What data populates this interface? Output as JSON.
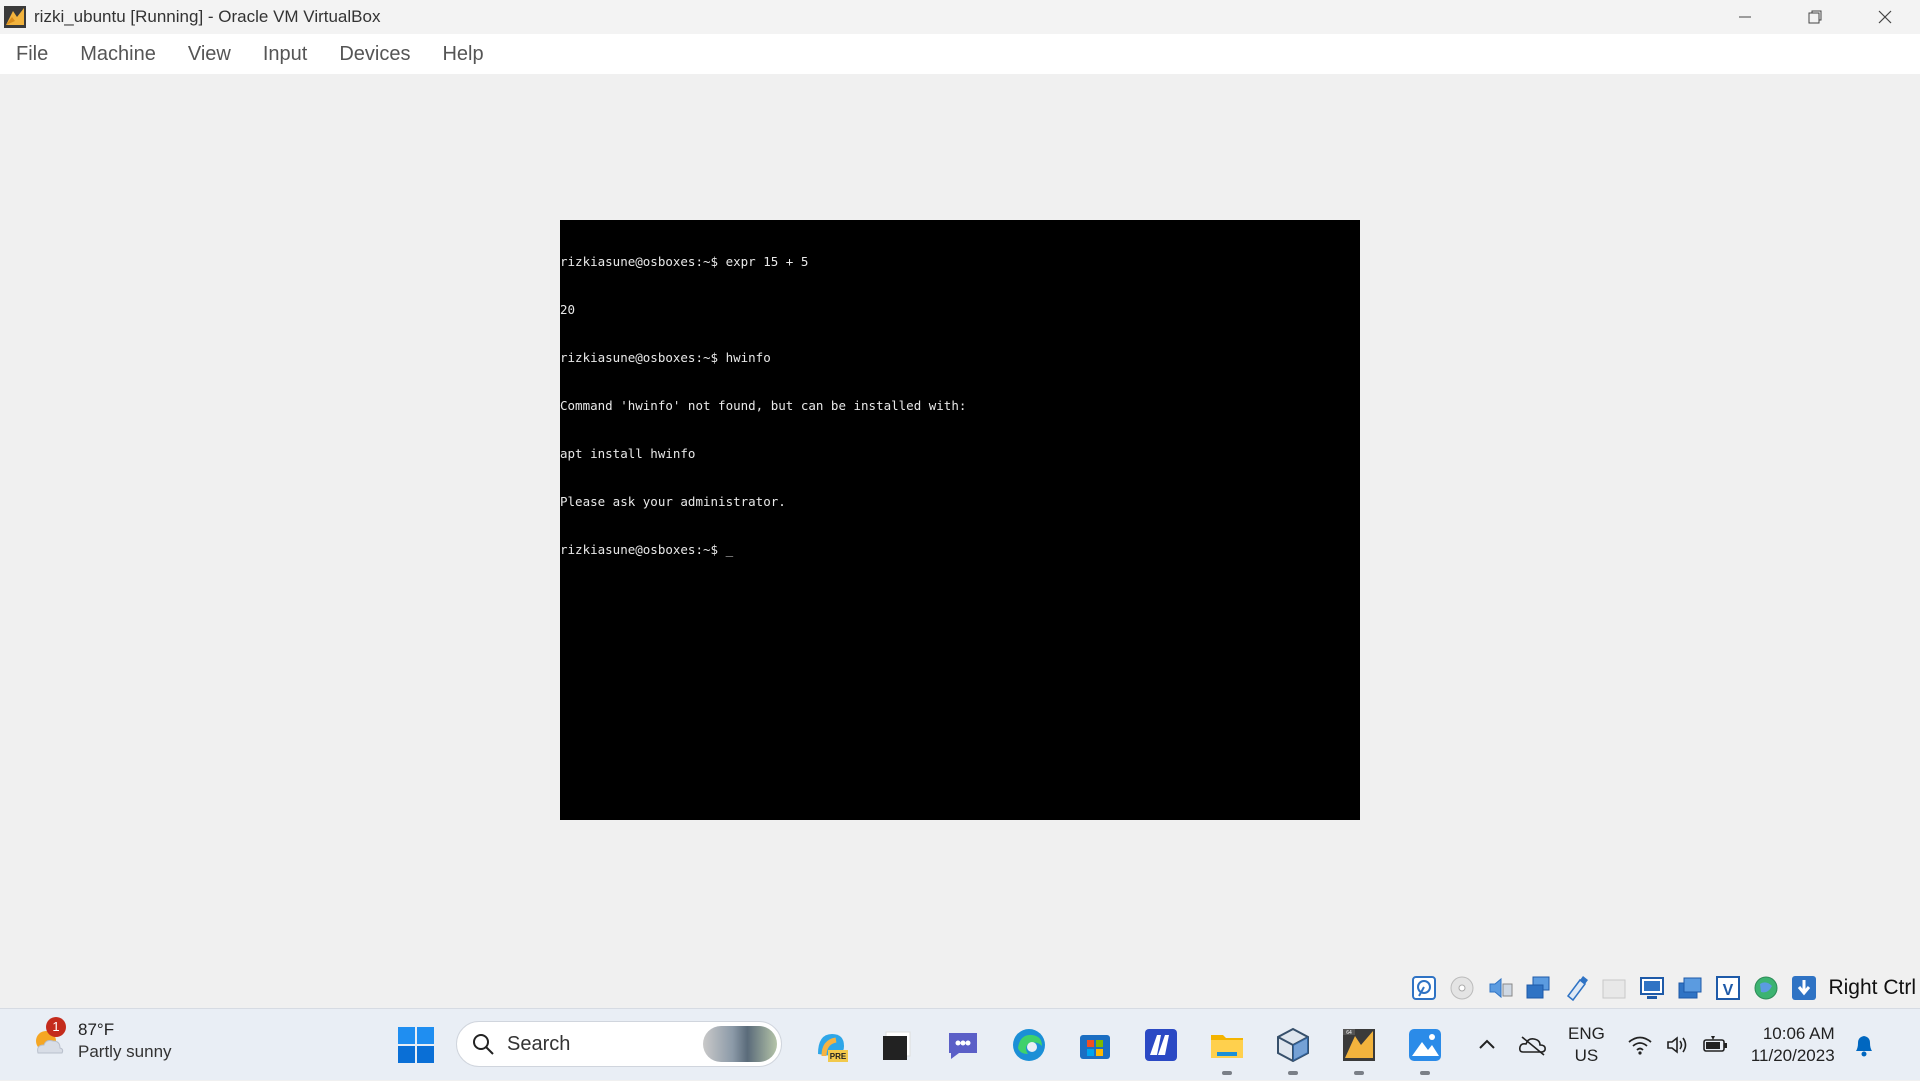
{
  "window": {
    "title": "rizki_ubuntu [Running] - Oracle VM VirtualBox"
  },
  "menu": {
    "items": [
      "File",
      "Machine",
      "View",
      "Input",
      "Devices",
      "Help"
    ]
  },
  "terminal": {
    "lines": [
      "rizkiasune@osboxes:~$ expr 15 + 5",
      "20",
      "rizkiasune@osboxes:~$ hwinfo",
      "Command 'hwinfo' not found, but can be installed with:",
      "apt install hwinfo",
      "Please ask your administrator.",
      "rizkiasune@osboxes:~$ _"
    ]
  },
  "status_bar": {
    "icons": [
      "hard-disk-icon",
      "optical-drive-icon",
      "audio-icon",
      "network-icon",
      "usb-icon",
      "shared-folders-icon",
      "display-icon",
      "recording-icon",
      "vt-x-icon",
      "guest-additions-icon",
      "mouse-integration-icon"
    ],
    "host_key": "Right Ctrl"
  },
  "taskbar": {
    "weather": {
      "temp": "87°F",
      "desc": "Partly sunny",
      "badge": "1"
    },
    "search": {
      "label": "Search"
    },
    "apps": [
      "copilot-preview",
      "terminal-app",
      "teams-chat",
      "edge-browser",
      "microsoft-store",
      "app-m",
      "file-explorer",
      "virtualbox",
      "virtualbox-vm",
      "photos"
    ],
    "language": {
      "line1": "ENG",
      "line2": "US"
    },
    "clock": {
      "time": "10:06 AM",
      "date": "11/20/2023"
    }
  },
  "colors": {
    "terminal_bg": "#000000",
    "terminal_fg": "#e8e8e8",
    "accent_blue": "#0067c0"
  }
}
